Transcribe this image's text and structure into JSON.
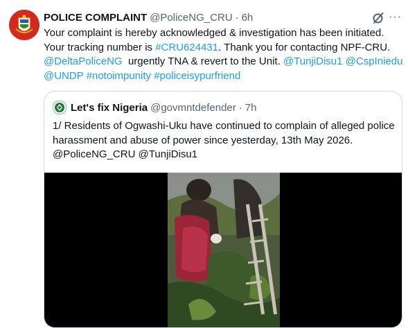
{
  "tweet": {
    "display_name": "POLICE COMPLAINT",
    "handle": "@PoliceNG_CRU",
    "separator": "·",
    "time": "6h",
    "text_parts": [
      "Your complaint is hereby acknowledged & investigation has been initiated. Your tracking number is ",
      "#CRU624431",
      ". Thank you for contacting NPF-CRU. ",
      "@DeltaPoliceNG",
      "  urgently TNA & revert to the Unit. ",
      "@TunjiDisu1",
      " ",
      "@CspIniedu",
      " ",
      "@UNDP",
      " ",
      "#notoimpunity",
      " ",
      "#policeisypurfriend"
    ],
    "more_label": "···"
  },
  "quote": {
    "display_name": "Let's fix Nigeria",
    "handle": "@govmntdefender",
    "separator": "·",
    "time": "7h",
    "text": "1/ Residents of Ogwashi-Uku have continued to complain of alleged police harassment and abuse of power since yesterday, 13th May 2026. @PoliceNG_CRU @TunjiDisu1"
  },
  "colors": {
    "link": "#1d9bf0",
    "secondary_text": "#536471",
    "border": "#cfd9de"
  },
  "icons": {
    "grok": "grok-icon",
    "more": "more-icon"
  }
}
